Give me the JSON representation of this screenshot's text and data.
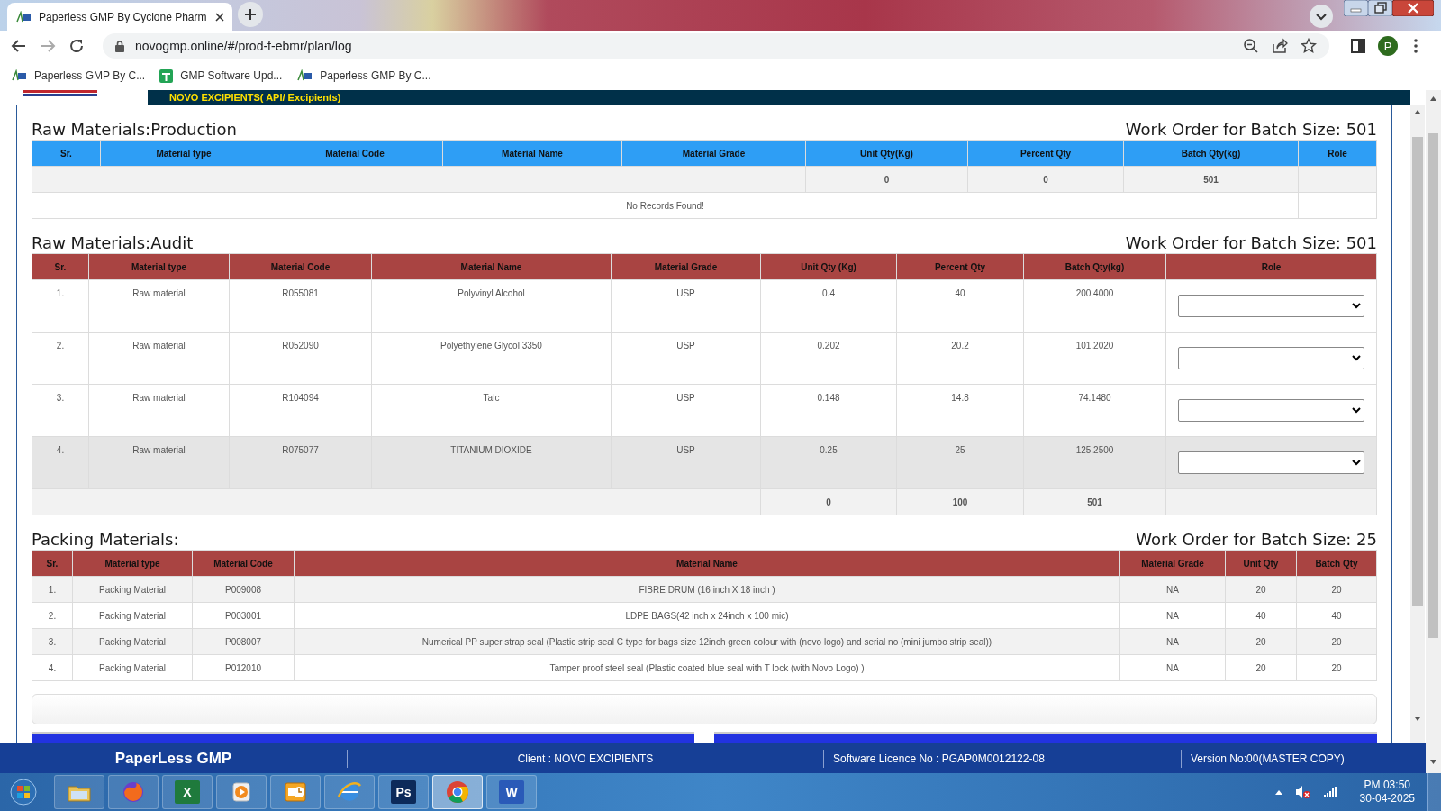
{
  "browser": {
    "tab": {
      "title": "Paperless GMP By Cyclone Pharm"
    },
    "address": {
      "url": "novogmp.online/#/prod-f-ebmr/plan/log"
    },
    "bookmarks": [
      {
        "kind": "gmp",
        "label": "Paperless GMP By C..."
      },
      {
        "kind": "sheet",
        "label": "GMP Software Upd..."
      },
      {
        "kind": "gmp",
        "label": "Paperless GMP By C..."
      }
    ],
    "profile": {
      "initial": "P"
    }
  },
  "app_header": {
    "company": "NOVO EXCIPIENTS( API/ Excipients)"
  },
  "sections": [
    {
      "kind": "production",
      "color": "#2e9ef5",
      "title": "Raw Materials:Production",
      "batch_title": "Work Order for Batch Size: 501",
      "columns": [
        "Sr.",
        "Material type",
        "Material Code",
        "Material Name",
        "Material Grade",
        "Unit Qty(Kg)",
        "Percent Qty",
        "Batch Qty(kg)",
        "Role"
      ],
      "rows": [
        {
          "kind": "total",
          "unit_qty": "0",
          "percent_qty": "0",
          "batch_qty": "501"
        },
        {
          "kind": "empty",
          "message": "No Records Found!"
        }
      ]
    },
    {
      "kind": "audit",
      "color": "#a94442",
      "title": "Raw Materials:Audit",
      "batch_title": "Work Order for Batch Size: 501",
      "columns": [
        "Sr.",
        "Material type",
        "Material Code",
        "Material Name",
        "Material Grade",
        "Unit Qty (Kg)",
        "Percent Qty",
        "Batch Qty(kg)",
        "Role"
      ],
      "rows": [
        {
          "kind": "data",
          "highlighted": false,
          "cells": [
            "1.",
            "Raw material",
            "R055081",
            "Polyvinyl Alcohol",
            "USP",
            "0.4",
            "40",
            "200.4000"
          ]
        },
        {
          "kind": "data",
          "highlighted": false,
          "cells": [
            "2.",
            "Raw material",
            "R052090",
            "Polyethylene Glycol 3350",
            "USP",
            "0.202",
            "20.2",
            "101.2020"
          ]
        },
        {
          "kind": "data",
          "highlighted": false,
          "cells": [
            "3.",
            "Raw material",
            "R104094",
            "Talc",
            "USP",
            "0.148",
            "14.8",
            "74.1480"
          ]
        },
        {
          "kind": "data",
          "highlighted": true,
          "cells": [
            "4.",
            "Raw material",
            "R075077",
            "TITANIUM DIOXIDE",
            "USP",
            "0.25",
            "25",
            "125.2500"
          ]
        },
        {
          "kind": "total",
          "unit_qty": "0",
          "percent_qty": "100",
          "batch_qty": "501"
        }
      ]
    },
    {
      "kind": "packing",
      "color": "#a94442",
      "title": "Packing Materials:",
      "batch_title": "Work Order for Batch Size: 25",
      "columns": [
        "Sr.",
        "Material type",
        "Material Code",
        "Material Name",
        "Material Grade",
        "Unit Qty",
        "Batch Qty"
      ],
      "rows": [
        {
          "kind": "data",
          "cells": [
            "1.",
            "Packing Material",
            "P009008",
            "FIBRE DRUM (16 inch X 18 inch )",
            "NA",
            "20",
            "20"
          ]
        },
        {
          "kind": "data",
          "cells": [
            "2.",
            "Packing Material",
            "P003001",
            "LDPE BAGS(42 inch x 24inch x 100 mic)",
            "NA",
            "40",
            "40"
          ]
        },
        {
          "kind": "data",
          "cells": [
            "3.",
            "Packing Material",
            "P008007",
            "Numerical PP super strap seal (Plastic strip seal C type for bags size 12inch green colour with (novo logo) and serial no (mini jumbo strip seal))",
            "NA",
            "20",
            "20"
          ]
        },
        {
          "kind": "data",
          "cells": [
            "4.",
            "Packing Material",
            "P012010",
            "Tamper proof steel seal (Plastic coated blue seal with T lock (with Novo Logo) )",
            "NA",
            "20",
            "20"
          ]
        }
      ]
    }
  ],
  "footer": {
    "brand": "PaperLess GMP",
    "client": "Client : NOVO EXCIPIENTS",
    "licence": "Software Licence No : PGAP0M0012122-08",
    "version": "Version No:00(MASTER COPY)"
  },
  "taskbar": {
    "apps": [
      {
        "kind": "folder",
        "selected": false
      },
      {
        "kind": "fox",
        "selected": false
      },
      {
        "kind": "badge",
        "label": "X",
        "color": "#1f7a3c",
        "selected": false
      },
      {
        "kind": "play",
        "selected": false
      },
      {
        "kind": "mail",
        "selected": false
      },
      {
        "kind": "globe",
        "selected": false
      },
      {
        "kind": "badge",
        "label": "Ps",
        "color": "#0c2a5a",
        "selected": false
      },
      {
        "kind": "chrome",
        "selected": true
      },
      {
        "kind": "badge",
        "label": "W",
        "color": "#2a5ab8",
        "selected": false
      }
    ],
    "time": "PM 03:50",
    "date": "30-04-2025"
  }
}
